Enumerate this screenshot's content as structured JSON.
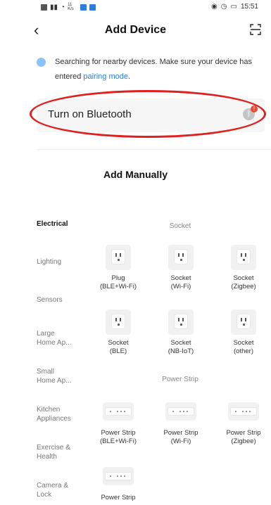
{
  "status_bar": {
    "left_text": "11 K/s",
    "time": "15:51"
  },
  "header": {
    "title": "Add Device",
    "back_icon": "back-arrow-icon",
    "scan_icon": "scan-icon"
  },
  "search": {
    "text": "Searching for nearby devices. Make sure your device has entered",
    "link": "pairing mode",
    "suffix": "."
  },
  "bluetooth": {
    "label": "Turn on Bluetooth",
    "badge": "!"
  },
  "manual": {
    "title": "Add Manually"
  },
  "sidebar": {
    "items": [
      {
        "label": "Electrical",
        "active": true
      },
      {
        "label": "Lighting"
      },
      {
        "label": "Sensors"
      },
      {
        "label": "Large\nHome Ap..."
      },
      {
        "label": "Small\nHome Ap..."
      },
      {
        "label": "Kitchen\nAppliances"
      },
      {
        "label": "Exercise &\nHealth"
      },
      {
        "label": "Camera &\nLock"
      }
    ]
  },
  "categories": {
    "socket": {
      "title": "Socket",
      "devices": [
        {
          "label": "Plug\n(BLE+Wi-Fi)"
        },
        {
          "label": "Socket\n(Wi-Fi)"
        },
        {
          "label": "Socket\n(Zigbee)"
        },
        {
          "label": "Socket\n(BLE)"
        },
        {
          "label": "Socket\n(NB-IoT)"
        },
        {
          "label": "Socket\n(other)"
        }
      ]
    },
    "power_strip": {
      "title": "Power Strip",
      "devices": [
        {
          "label": "Power Strip\n(BLE+Wi-Fi)"
        },
        {
          "label": "Power Strip\n(Wi-Fi)"
        },
        {
          "label": "Power Strip\n(Zigbee)"
        },
        {
          "label": "Power Strip"
        }
      ]
    }
  },
  "colors": {
    "link": "#2a7de1",
    "highlight": "#e02020",
    "badge": "#e84a3a"
  }
}
